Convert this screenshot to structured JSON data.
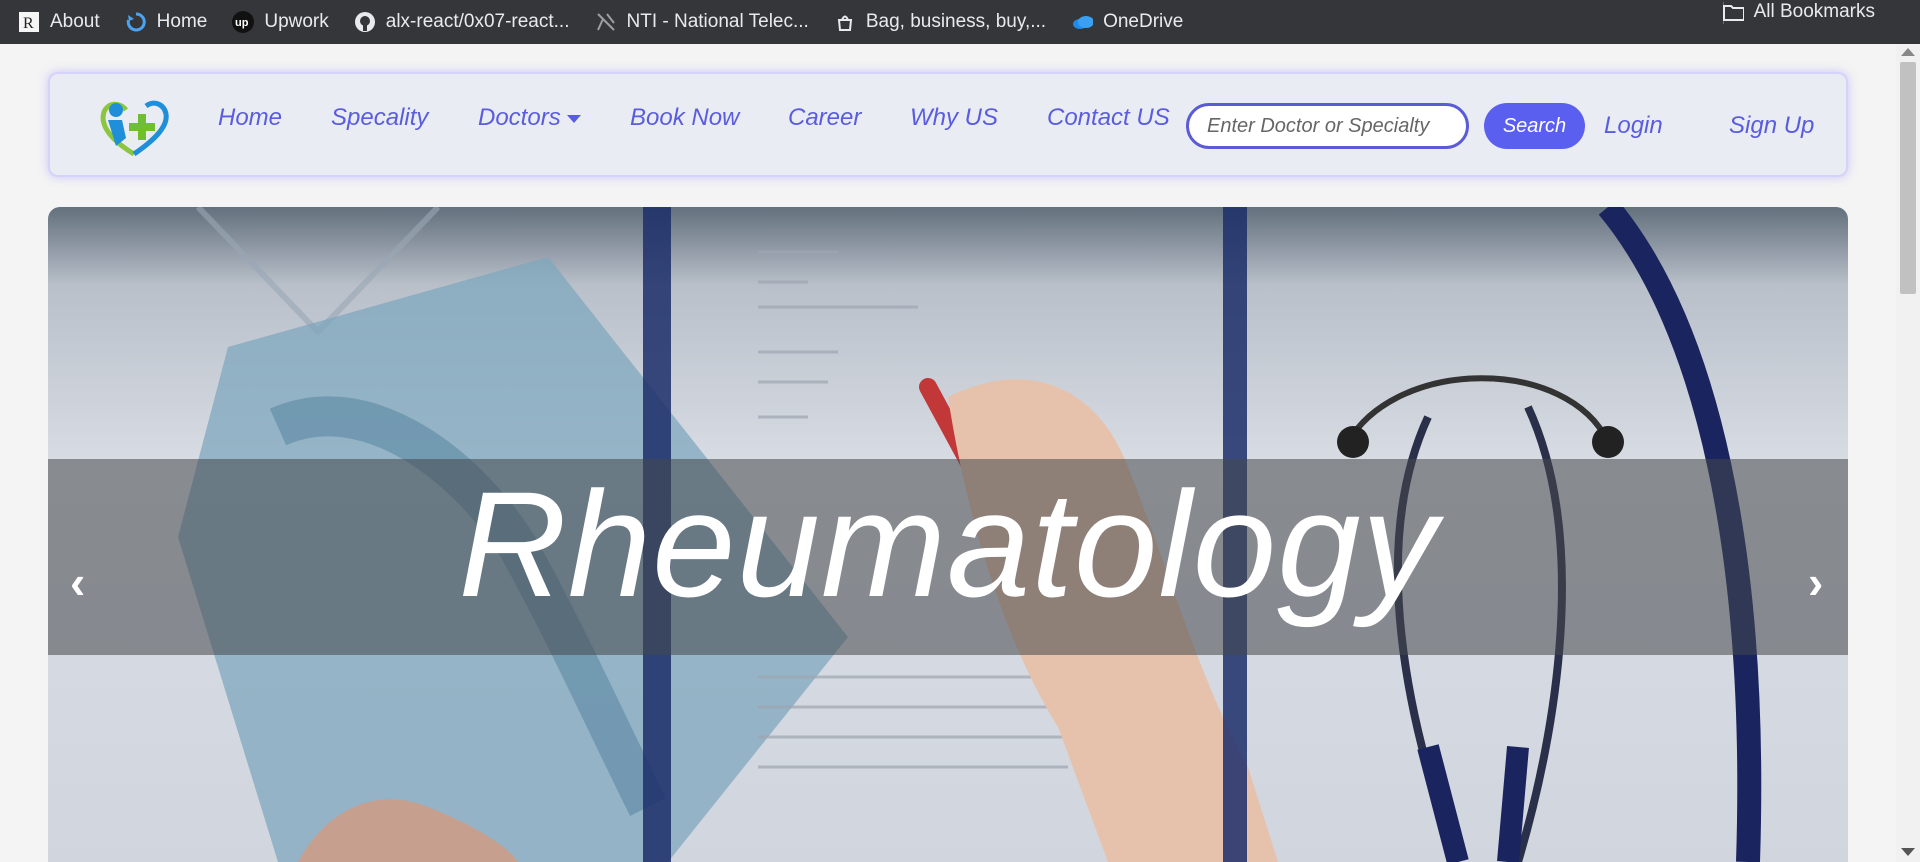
{
  "bookmarks": [
    {
      "label": "About",
      "icon": "r-icon"
    },
    {
      "label": "Home",
      "icon": "refresh-icon"
    },
    {
      "label": "Upwork",
      "icon": "upwork-icon"
    },
    {
      "label": "alx-react/0x07-react...",
      "icon": "github-icon"
    },
    {
      "label": "NTI - National Telec...",
      "icon": "nti-icon"
    },
    {
      "label": "Bag, business, buy,...",
      "icon": "bag-icon"
    },
    {
      "label": "OneDrive",
      "icon": "onedrive-icon"
    }
  ],
  "all_bookmarks": {
    "label": "All Bookmarks",
    "icon": "folder-icon"
  },
  "nav": {
    "logo": "medical-logo",
    "links": [
      "Home",
      "Specality",
      "Doctors",
      "Book Now",
      "Career",
      "Why US",
      "Contact US"
    ],
    "search_placeholder": "Enter Doctor or Specialty",
    "search_button": "Search",
    "login": "Login",
    "signup": "Sign Up"
  },
  "hero": {
    "caption": "Rheumatology",
    "prev_arrow": "‹",
    "next_arrow": "›"
  },
  "colors": {
    "accent": "#5b5ff0",
    "link": "#5a5ce0",
    "bookmark_bar": "#35363a"
  }
}
